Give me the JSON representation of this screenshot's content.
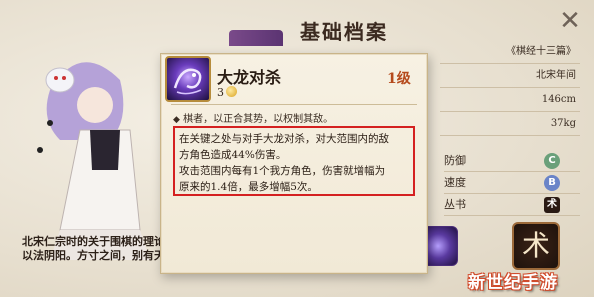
{
  "header": {
    "title": "基础档案",
    "close_icon": "close-icon"
  },
  "info": {
    "rows": [
      "《棋经十三篇》",
      "北宋年间",
      "146cm",
      "37kg"
    ]
  },
  "stats": [
    {
      "label": "防御",
      "badge": "C",
      "color": "#6aa07a"
    },
    {
      "label": "速度",
      "badge": "B",
      "color": "#6a84c8"
    },
    {
      "label": "丛书",
      "badge": "术",
      "color": "#2a1a14"
    }
  ],
  "seal": {
    "glyph": "术"
  },
  "description": {
    "line1": "北宋仁宗时的关于围棋的理论",
    "line2": "以法阴阳。方寸之间，别有天地。"
  },
  "skill_popup": {
    "name": "大龙对杀",
    "level": "1级",
    "cost": "3",
    "cost_icon": "coin-icon",
    "subtitle": "棋者，以正合其势，以权制其敌。",
    "subtitle_icon": "diamond-icon",
    "effect_line1": "在关键之处与对手大龙对杀，对大范围内的敌",
    "effect_line2": "方角色造成44%伤害。",
    "effect_line3": "攻击范围内每有1个我方角色，伤害就增幅为",
    "effect_line4": "原来的1.4倍，最多增幅5次。",
    "highlight_color": "#d42020"
  },
  "watermark": "新世纪手游"
}
